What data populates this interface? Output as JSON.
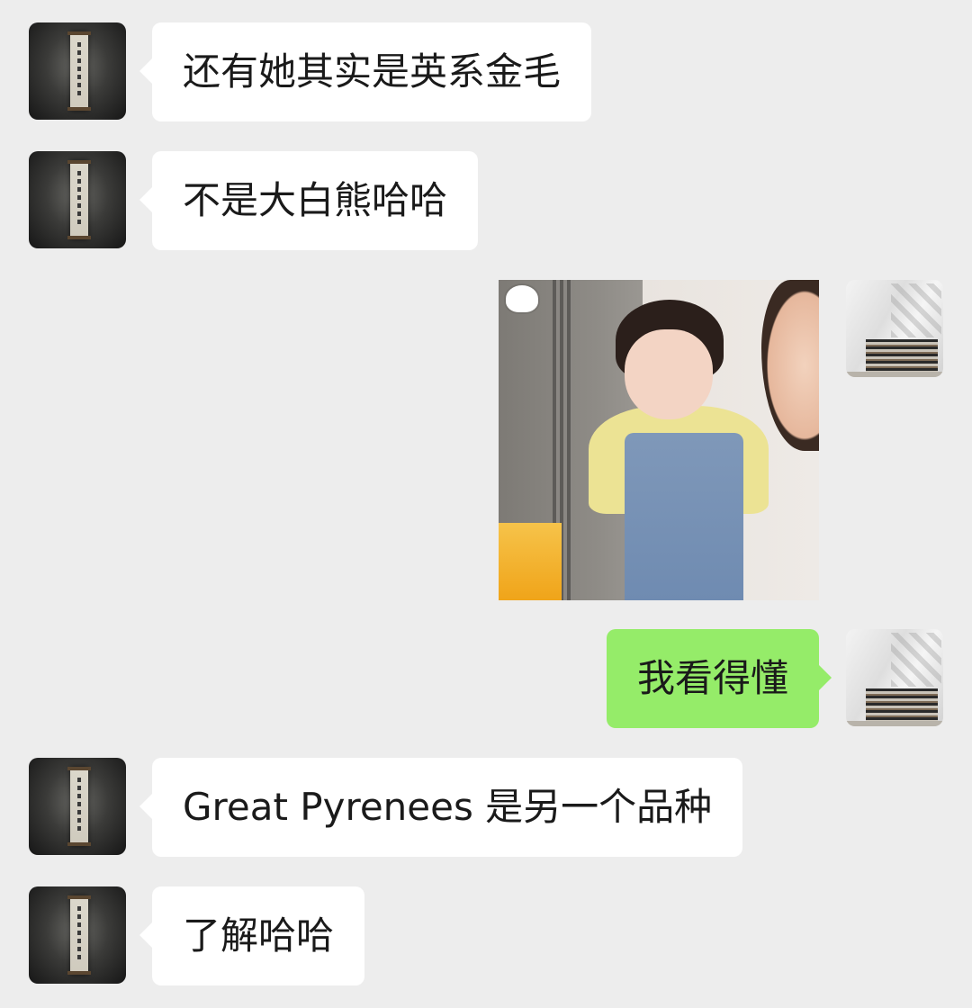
{
  "messages": [
    {
      "sender": "friend",
      "type": "text",
      "text": "还有她其实是英系金毛"
    },
    {
      "sender": "friend",
      "type": "text",
      "text": "不是大白熊哈哈"
    },
    {
      "sender": "self",
      "type": "sticker",
      "description_icon": "sticker-image"
    },
    {
      "sender": "self",
      "type": "text",
      "text": "我看得懂"
    },
    {
      "sender": "friend",
      "type": "text",
      "text": "Great Pyrenees 是另一个品种"
    },
    {
      "sender": "friend",
      "type": "text",
      "text": "了解哈哈"
    }
  ],
  "colors": {
    "background": "#ededed",
    "incoming_bubble": "#ffffff",
    "outgoing_bubble": "#95ec69",
    "text": "#1a1a1a"
  }
}
